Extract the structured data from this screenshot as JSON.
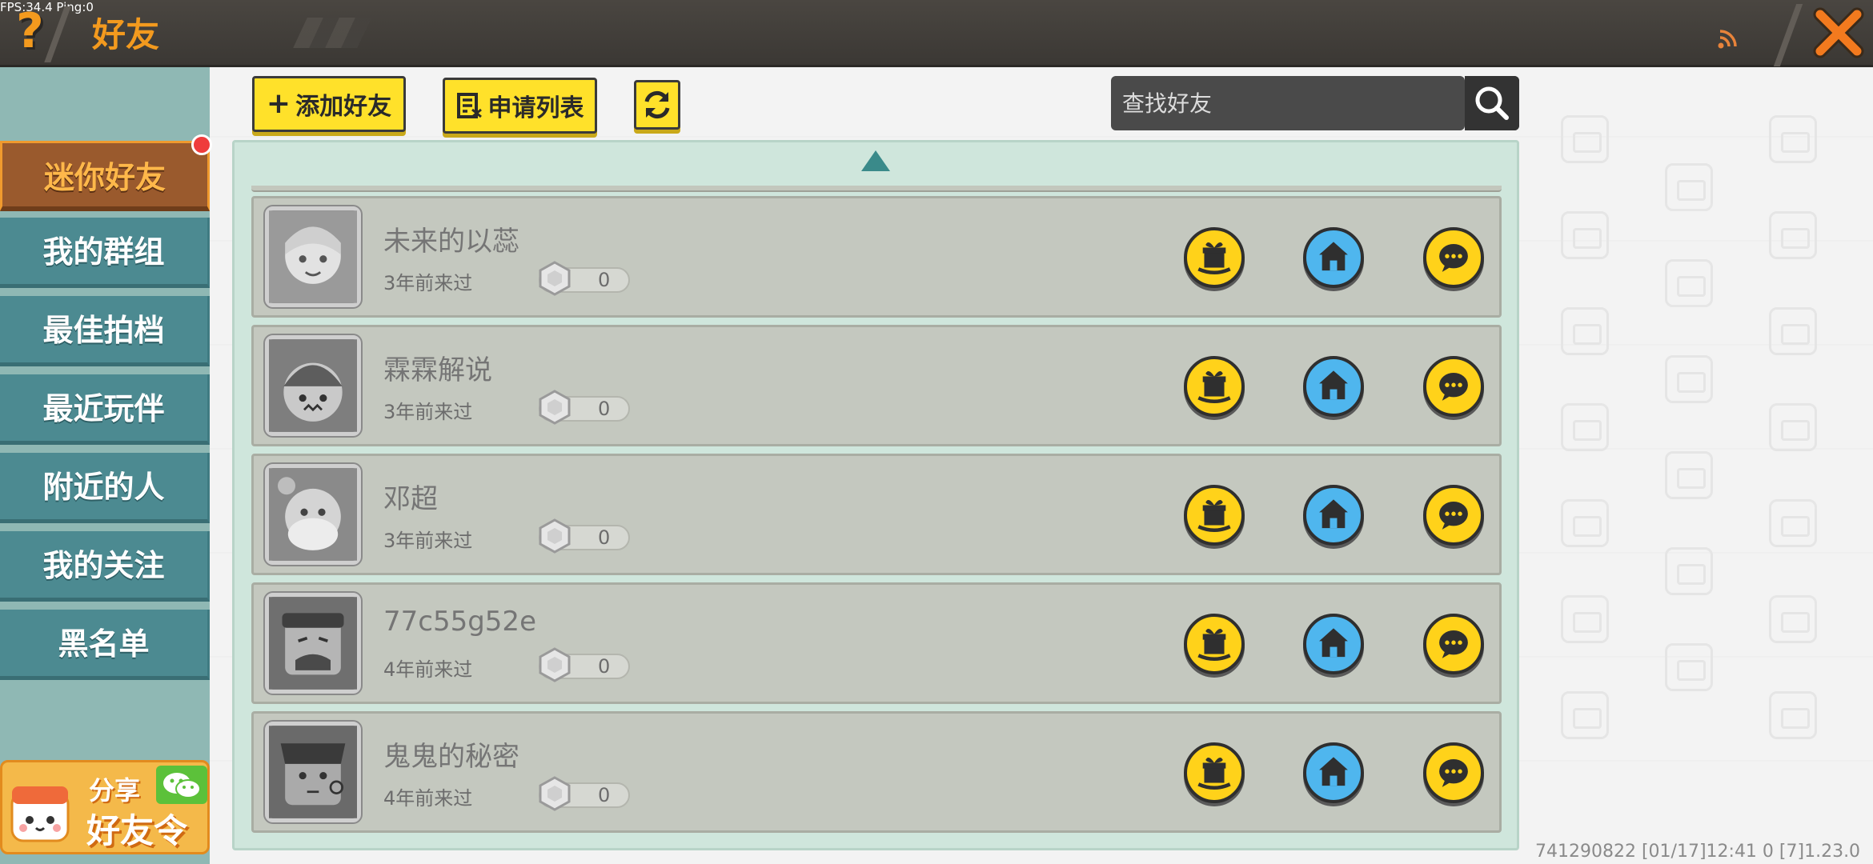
{
  "status": {
    "fps": "FPS:34.4  Ping:0"
  },
  "header": {
    "help_icon": "?",
    "title": "好友",
    "icons": [
      "question-icon",
      "signal-icon",
      "close-icon"
    ]
  },
  "sidebar": {
    "tabs": [
      {
        "label": "迷你好友",
        "active": true
      },
      {
        "label": "我的群组"
      },
      {
        "label": "最佳拍档"
      },
      {
        "label": "最近玩伴"
      },
      {
        "label": "附近的人"
      },
      {
        "label": "我的关注"
      },
      {
        "label": "黑名单"
      }
    ],
    "share": {
      "line1": "分享",
      "line2": "好友令"
    }
  },
  "toolbar": {
    "add_label": "添加好友",
    "apply_label": "申请列表",
    "search_placeholder": "查找好友"
  },
  "friends": [
    {
      "name": "未来的以蕊",
      "last_seen": "3年前来过",
      "score": "0"
    },
    {
      "name": "霖霖解说",
      "last_seen": "3年前来过",
      "score": "0"
    },
    {
      "name": "邓超",
      "last_seen": "3年前来过",
      "score": "0"
    },
    {
      "name": "77c55g52e",
      "last_seen": "4年前来过",
      "score": "0"
    },
    {
      "name": "鬼鬼的秘密",
      "last_seen": "4年前来过",
      "score": "0"
    }
  ],
  "footer": {
    "info": "741290822    [01/17]12:41 0    [7]1.23.0"
  },
  "colors": {
    "accent_orange": "#f39a1e",
    "tab_teal": "#4c8a91",
    "button_yellow": "#ffe12a",
    "home_blue": "#4fb6ee"
  }
}
